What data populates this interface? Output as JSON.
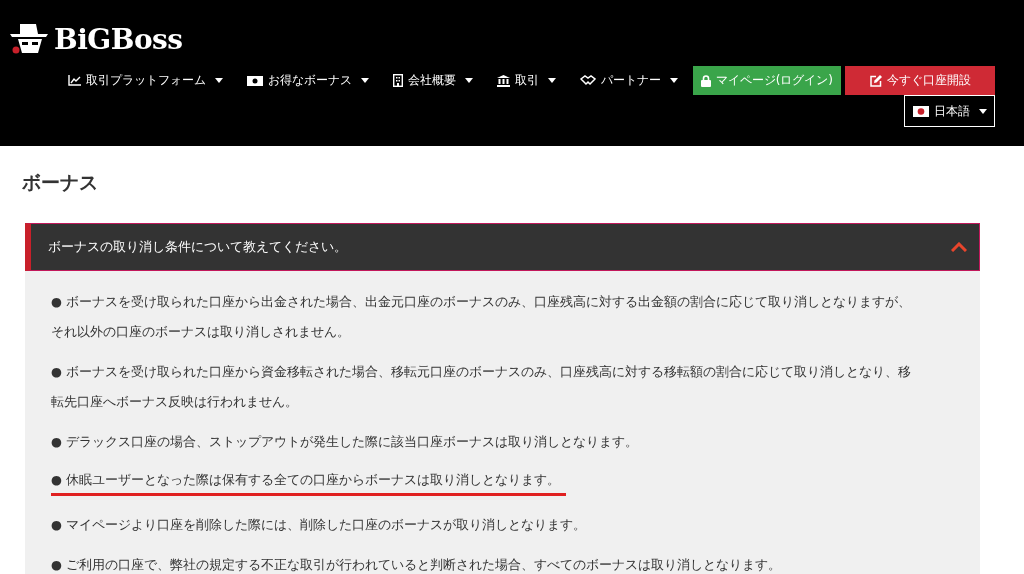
{
  "header": {
    "logo": "BiGBoss",
    "nav": [
      {
        "label": "取引プラットフォーム"
      },
      {
        "label": "お得なボーナス"
      },
      {
        "label": "会社概要"
      },
      {
        "label": "取引"
      },
      {
        "label": "パートナー"
      }
    ],
    "login_button": "マイページ(ログイン)",
    "signup_button": "今すぐ口座開設",
    "language": "日本語"
  },
  "page_title": "ボーナス",
  "faq": {
    "question": "ボーナスの取り消し条件について教えてください。",
    "expanded": true,
    "answers": [
      {
        "text": "● ボーナスを受け取られた口座から出金された場合、出金元口座のボーナスのみ、口座残高に対する出金額の割合に応じて取り消しとなりますが、それ以外の口座のボーナスは取り消しされません。",
        "underlined": false
      },
      {
        "text": "● ボーナスを受け取られた口座から資金移転された場合、移転元口座のボーナスのみ、口座残高に対する移転額の割合に応じて取り消しとなり、移転先口座へボーナス反映は行われません。",
        "underlined": false
      },
      {
        "text": "● デラックス口座の場合、ストップアウトが発生した際に該当口座ボーナスは取り消しとなります。",
        "underlined": false
      },
      {
        "text": "● 休眠ユーザーとなった際は保有する全ての口座からボーナスは取り消しとなります。",
        "underlined": true
      },
      {
        "text": "● マイページより口座を削除した際には、削除した口座のボーナスが取り消しとなります。",
        "underlined": false
      },
      {
        "text": "● ご利用の口座で、弊社の規定する不正な取引が行われていると判断された場合、すべてのボーナスは取り消しとなります。",
        "underlined": false
      }
    ]
  }
}
